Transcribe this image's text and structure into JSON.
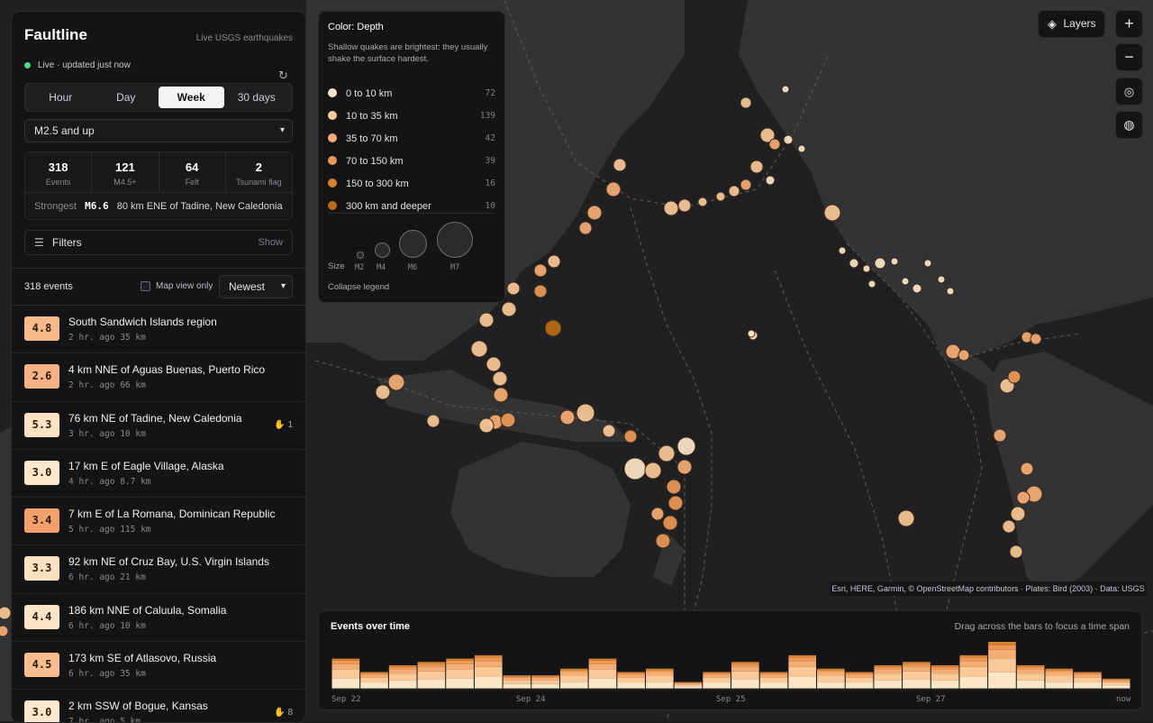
{
  "app": {
    "title": "Faultline",
    "subtitle": "Live USGS earthquakes",
    "live_status": "Live · updated just now"
  },
  "time_tabs": [
    "Hour",
    "Day",
    "Week",
    "30 days"
  ],
  "active_tab": "Week",
  "magnitude_filter": "M2.5 and up",
  "stats": [
    {
      "value": "318",
      "label": "Events"
    },
    {
      "value": "121",
      "label": "M4.5+"
    },
    {
      "value": "64",
      "label": "Felt"
    },
    {
      "value": "2",
      "label": "Tsunami flag"
    }
  ],
  "strongest": {
    "label": "Strongest",
    "mag": "M6.6",
    "place": "80 km ENE of Tadine, New Caledonia"
  },
  "filters": {
    "label": "Filters",
    "toggle": "Show"
  },
  "list": {
    "count_label": "318 events",
    "map_view_only": "Map view only",
    "sort": "Newest"
  },
  "events": [
    {
      "mag": "4.8",
      "place": "South Sandwich Islands region",
      "meta": "2 hr. ago  35 km",
      "color": "#f9b98a",
      "felt": ""
    },
    {
      "mag": "2.6",
      "place": "4 km NNE of Aguas Buenas, Puerto Rico",
      "meta": "2 hr. ago  66 km",
      "color": "#f6b284",
      "felt": ""
    },
    {
      "mag": "5.3",
      "place": "76 km NE of Tadine, New Caledonia",
      "meta": "3 hr. ago  10 km",
      "color": "#fde3c4",
      "felt": "1"
    },
    {
      "mag": "3.0",
      "place": "17 km E of Eagle Village, Alaska",
      "meta": "4 hr. ago  8.7 km",
      "color": "#fde8cc",
      "felt": ""
    },
    {
      "mag": "3.4",
      "place": "7 km E of La Romana, Dominican Republic",
      "meta": "5 hr. ago  115 km",
      "color": "#f4a06a",
      "felt": ""
    },
    {
      "mag": "3.3",
      "place": "92 km NE of Cruz Bay, U.S. Virgin Islands",
      "meta": "6 hr. ago  21 km",
      "color": "#fde0bf",
      "felt": ""
    },
    {
      "mag": "4.4",
      "place": "186 km NNE of Caluula, Somalia",
      "meta": "6 hr. ago  10 km",
      "color": "#fde4c6",
      "felt": ""
    },
    {
      "mag": "4.5",
      "place": "173 km SE of Atlasovo, Russia",
      "meta": "6 hr. ago  35 km",
      "color": "#f9bc8d",
      "felt": ""
    },
    {
      "mag": "3.0",
      "place": "2 km SSW of Bogue, Kansas",
      "meta": "7 hr. ago  5 km",
      "color": "#fde8cc",
      "felt": "8"
    }
  ],
  "legend": {
    "title": "Color: Depth",
    "description": "Shallow quakes are brightest: they usually shake the surface hardest.",
    "depth_bins": [
      {
        "label": "0 to 10 km",
        "count": "72",
        "color": "#fde6c8"
      },
      {
        "label": "10 to 35 km",
        "count": "139",
        "color": "#f9c998"
      },
      {
        "label": "35 to 70 km",
        "count": "42",
        "color": "#f6ad74"
      },
      {
        "label": "70 to 150 km",
        "count": "39",
        "color": "#ec9856"
      },
      {
        "label": "150 to 300 km",
        "count": "16",
        "color": "#d9822e"
      },
      {
        "label": "300 km and deeper",
        "count": "10",
        "color": "#b96d12"
      }
    ],
    "size_label": "Size",
    "sizes": [
      "M2",
      "M4",
      "M6",
      "M7"
    ],
    "collapse": "Collapse legend"
  },
  "map_controls": {
    "layers": "Layers"
  },
  "attribution": "Esri, HERE, Garmin, © OpenStreetMap contributors · Plates: Bird (2003) · Data: USGS",
  "timeline": {
    "title": "Events over time",
    "hint": "Drag across the bars to focus a time span",
    "x_labels": [
      "Sep 22",
      "Sep 24",
      "Sep 25",
      "Sep 27",
      "now"
    ]
  },
  "chart_data": {
    "type": "bar",
    "stacked": true,
    "x_labels": [
      "Sep 22",
      "Sep 24",
      "Sep 25",
      "Sep 27",
      "now"
    ],
    "values": [
      9,
      5,
      7,
      8,
      9,
      10,
      4,
      4,
      6,
      9,
      5,
      6,
      2,
      5,
      8,
      5,
      10,
      6,
      5,
      7,
      8,
      7,
      10,
      14,
      7,
      6,
      5,
      3
    ]
  }
}
